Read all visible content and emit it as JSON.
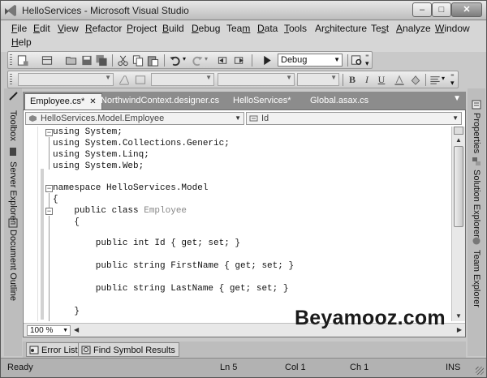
{
  "window": {
    "title": "HelloServices - Microsoft Visual Studio",
    "minimize_label": "–",
    "maximize_label": "□",
    "close_label": "✕"
  },
  "menu": [
    {
      "label": "File",
      "u": "F",
      "rest": "ile"
    },
    {
      "label": "Edit",
      "u": "E",
      "rest": "dit"
    },
    {
      "label": "View",
      "u": "V",
      "rest": "iew"
    },
    {
      "label": "Refactor",
      "u": "R",
      "rest": "efactor"
    },
    {
      "label": "Project",
      "u": "P",
      "rest": "roject"
    },
    {
      "label": "Build",
      "u": "B",
      "rest": "uild"
    },
    {
      "label": "Debug",
      "u": "D",
      "rest": "ebug"
    },
    {
      "label": "Team",
      "pre": "Tea",
      "u": "m",
      "rest": ""
    },
    {
      "label": "Data",
      "u": "D",
      "rest": "ata"
    },
    {
      "label": "Tools",
      "u": "T",
      "rest": "ools"
    },
    {
      "label": "Architecture",
      "pre": "Ar",
      "u": "c",
      "rest": "hitecture"
    },
    {
      "label": "Test",
      "pre": "Te",
      "u": "s",
      "rest": "t"
    },
    {
      "label": "Analyze",
      "u": "A",
      "rest": "nalyze"
    },
    {
      "label": "Window",
      "u": "W",
      "rest": "indow"
    },
    {
      "label": "Help",
      "u": "H",
      "rest": "elp"
    }
  ],
  "toolbar": {
    "solution_config": "Debug",
    "format_bold": "B",
    "format_italic": "I",
    "format_underline": "U"
  },
  "left_rail": [
    "Toolbox",
    "Server Explorer",
    "Document Outline"
  ],
  "right_rail": [
    "Properties",
    "Solution Explorer",
    "Team Explorer"
  ],
  "doc_tabs": [
    {
      "label": "Employee.cs*",
      "active": true,
      "close": "✕"
    },
    {
      "label": "NorthwindContext.designer.cs",
      "active": false
    },
    {
      "label": "HelloServices*",
      "active": false
    },
    {
      "label": "Global.asax.cs",
      "active": false
    }
  ],
  "editor": {
    "type_dropdown": "HelloServices.Model.Employee",
    "member_dropdown": "Id",
    "code_lines": [
      "using System;",
      "using System.Collections.Generic;",
      "using System.Linq;",
      "using System.Web;",
      "",
      "namespace HelloServices.Model",
      "{",
      "    public class Employee",
      "    {",
      "",
      "        public int Id { get; set; }",
      "",
      "        public string FirstName { get; set; }",
      "",
      "        public string LastName { get; set; }",
      "",
      "    }"
    ],
    "zoom": "100 %"
  },
  "watermark": "Beyamooz.com",
  "bottom_tabs": [
    "Error List",
    "Find Symbol Results"
  ],
  "status": {
    "ready": "Ready",
    "line": "Ln 5",
    "col": "Col 1",
    "ch": "Ch 1",
    "mode": "INS"
  }
}
